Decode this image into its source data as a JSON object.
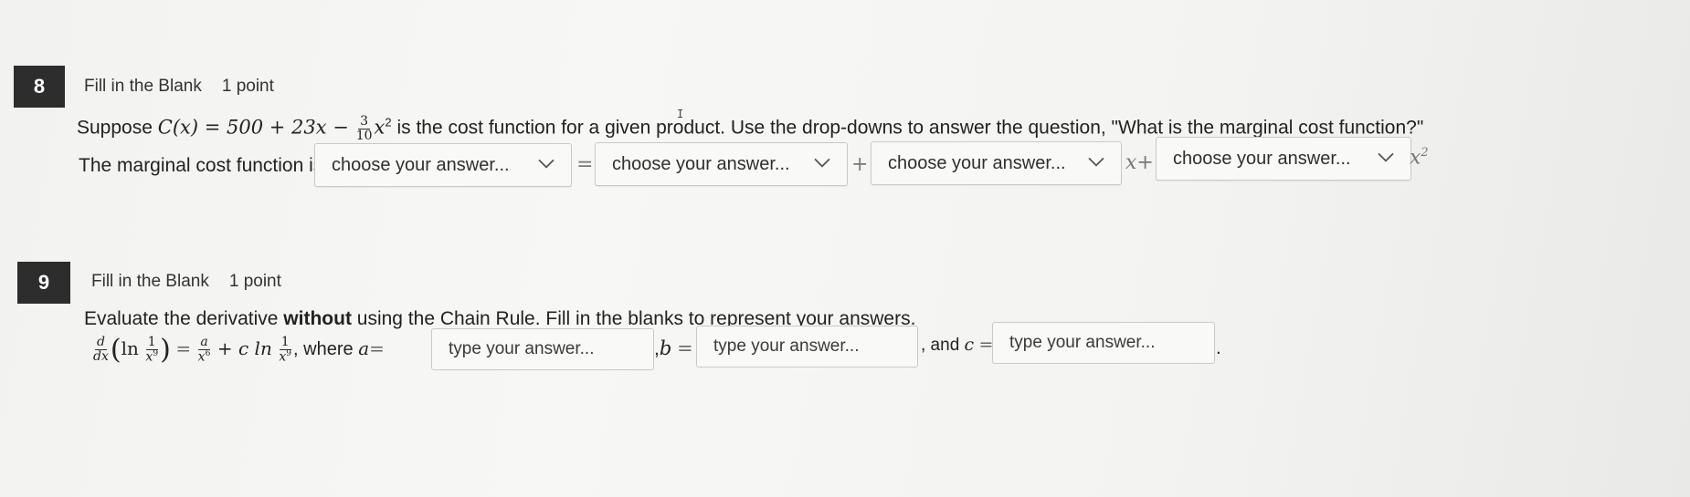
{
  "q8": {
    "number": "8",
    "type": "Fill in the Blank",
    "points": "1 point",
    "prompt_prefix": "Suppose",
    "prompt_cx": "C(x) = 500 + 23x −",
    "frac_num": "3",
    "frac_den": "10",
    "prompt_x2": "x",
    "prompt_sup": "2",
    "prompt_suffix": "is the cost function for a given product. Use the drop-downs to answer the question, \"What is the marginal cost function?\"",
    "answer_label": "The marginal cost function is",
    "dropdown_placeholder": "choose your answer...",
    "op_equals": "=",
    "op_plus": "+",
    "op_xplus": "x+",
    "trail_x": "x",
    "trail_sup": "2"
  },
  "q9": {
    "number": "9",
    "type": "Fill in the Blank",
    "points": "1 point",
    "instruction_pre": "Evaluate the derivative ",
    "instruction_bold": "without",
    "instruction_post": " using the Chain Rule. Fill in the blanks to represent your answers.",
    "d_num": "d",
    "d_den": "dx",
    "ln": "ln",
    "one": "1",
    "x9": "x",
    "sup9": "9",
    "eq": "=",
    "a_num": "a",
    "a_den": "x",
    "sup6": "6",
    "plus_c_ln": "+ c ln",
    "where": ", where",
    "a_var": "a",
    "b_var": "b",
    "and": ", and",
    "c_var": "c",
    "input_placeholder": "type your answer...",
    "period": "."
  }
}
